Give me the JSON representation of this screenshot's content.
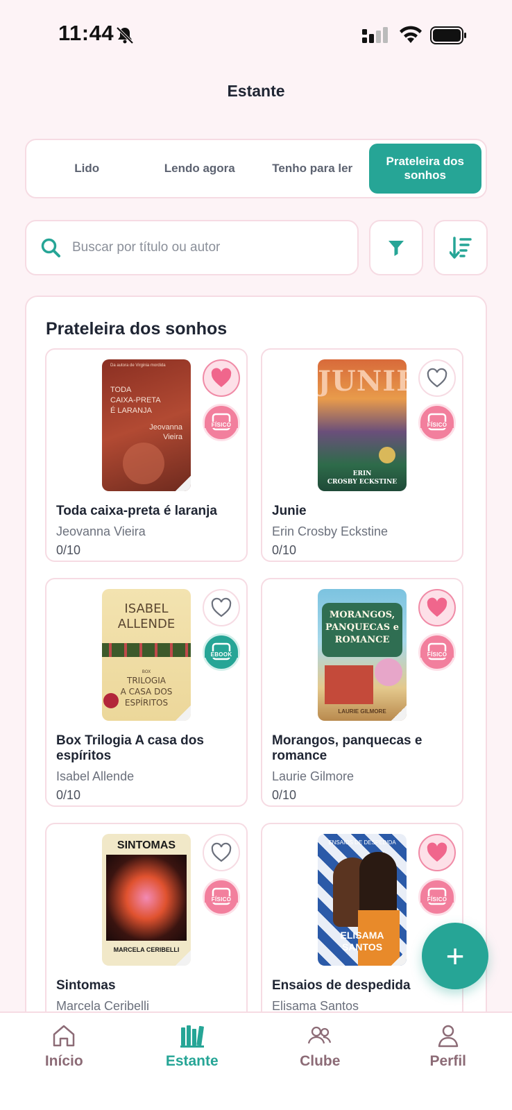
{
  "status_bar": {
    "time": "11:44"
  },
  "header": {
    "title": "Estante"
  },
  "tabs": [
    {
      "label": "Lido",
      "active": false
    },
    {
      "label": "Lendo agora",
      "active": false
    },
    {
      "label": "Tenho para ler",
      "active": false
    },
    {
      "label": "Prateleira dos sonhos",
      "active": true
    }
  ],
  "search": {
    "placeholder": "Buscar por título ou autor",
    "value": ""
  },
  "panel": {
    "title": "Prateleira dos sonhos"
  },
  "books": [
    {
      "title": "Toda caixa-preta é laranja",
      "author": "Jeovanna Vieira",
      "progress": "0/10",
      "favorite": true,
      "format": "FÍSICO",
      "cover_text": [
        "Da autora de Virginia mordida",
        "TODA",
        "CAIXA-PRETA",
        "É LARANJA",
        "Jeovanna",
        "Vieira"
      ]
    },
    {
      "title": "Junie",
      "author": "Erin Crosby Eckstine",
      "progress": "0/10",
      "favorite": false,
      "format": "FÍSICO",
      "cover_text": [
        "JUNIE",
        "ERIN",
        "CROSBY ECKSTINE"
      ]
    },
    {
      "title": "Box Trilogia A casa dos espíritos",
      "author": "Isabel Allende",
      "progress": "0/10",
      "favorite": false,
      "format": "EBOOK",
      "cover_text": [
        "ISABEL",
        "ALLENDE",
        "BOX",
        "TRILOGIA",
        "A CASA DOS",
        "ESPÍRITOS"
      ]
    },
    {
      "title": "Morangos, panquecas e romance",
      "author": "Laurie Gilmore",
      "progress": "0/10",
      "favorite": true,
      "format": "FÍSICO",
      "cover_text": [
        "MORANGOS,",
        "PANQUECAS e",
        "ROMANCE",
        "LAURIE GILMORE"
      ]
    },
    {
      "title": "Sintomas",
      "author": "Marcela Ceribelli",
      "progress": "",
      "favorite": false,
      "format": "FÍSICO",
      "cover_text": [
        "SINTOMAS",
        "MARCELA CERIBELLI"
      ]
    },
    {
      "title": "Ensaios de despedida",
      "author": "Elisama Santos",
      "progress": "",
      "favorite": true,
      "format": "FÍSICO",
      "cover_text": [
        "ENSAIOS DE DESPEDIDA",
        "ELISAMA",
        "SANTOS"
      ]
    }
  ],
  "fab": {
    "label": "+"
  },
  "bottom_nav": [
    {
      "label": "Início",
      "icon": "home-icon",
      "active": false
    },
    {
      "label": "Estante",
      "icon": "bookshelf-icon",
      "active": true
    },
    {
      "label": "Clube",
      "icon": "group-icon",
      "active": false
    },
    {
      "label": "Perfil",
      "icon": "user-icon",
      "active": false
    }
  ],
  "colors": {
    "accent": "#26a596",
    "pink": "#f27f9d",
    "background": "#fdf3f6",
    "border": "#f6dbe3"
  }
}
